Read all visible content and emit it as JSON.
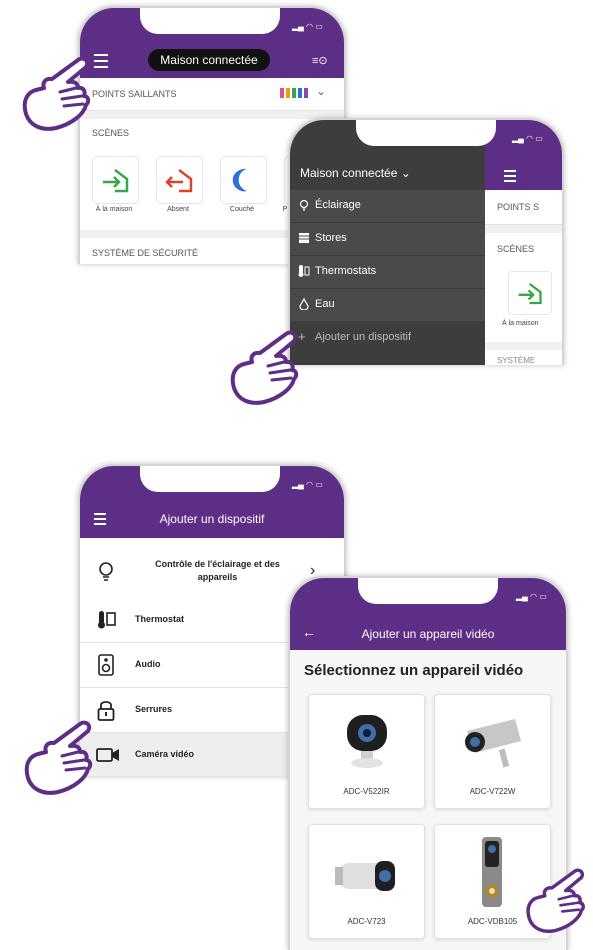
{
  "phone1": {
    "title": "Maison connectée",
    "highlights_label": "POINTS SAILLANTS",
    "scenes_label": "SCÈNES",
    "scenes": [
      "À la maison",
      "Absent",
      "Couché",
      "P"
    ],
    "security_label": "SYSTÈME DE SÉCURITÉ"
  },
  "phone2": {
    "dropdown_title": "Maison connectée",
    "menu": [
      "Éclairage",
      "Stores",
      "Thermostats",
      "Eau",
      "Ajouter un dispositif"
    ],
    "peek_highlights": "POINTS S",
    "peek_scenes": "SCÈNES",
    "peek_scene": "À la maison",
    "peek_security": "SYSTÈME"
  },
  "phone3": {
    "title": "Ajouter un dispositif",
    "items": [
      {
        "label": "Contrôle de l'éclairage et des appareils",
        "icon": "lightbulb-icon"
      },
      {
        "label": "Thermostat",
        "icon": "thermostat-icon"
      },
      {
        "label": "Audio",
        "icon": "speaker-icon"
      },
      {
        "label": "Serrures",
        "icon": "lock-icon"
      },
      {
        "label": "Caméra vidéo",
        "icon": "video-camera-icon"
      }
    ]
  },
  "phone4": {
    "title": "Ajouter un appareil vidéo",
    "heading": "Sélectionnez un appareil vidéo",
    "devices": [
      "ADC-V522IR",
      "ADC-V722W",
      "ADC-V723",
      "ADC-VDB105"
    ]
  },
  "colors": {
    "brand_purple": "#5d2e86",
    "dark_menu": "#4a4a4a",
    "green": "#3aa548",
    "red": "#d9442c",
    "blue": "#2f6fd6"
  }
}
